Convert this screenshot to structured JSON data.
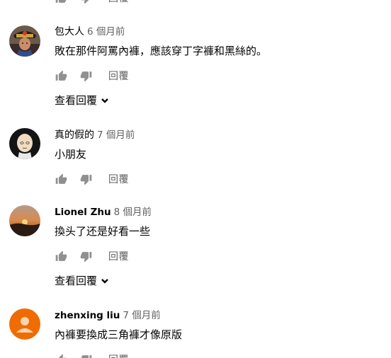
{
  "reply_label": "回覆",
  "view_replies_label": "查看回覆",
  "comments": [
    {
      "author": "包大人",
      "time": "6 個月前",
      "text": "敗在那件阿罵內褲，應該穿丁字褲和黑絲的。",
      "avatar": "costume-character-avatar"
    },
    {
      "author": "真的假的",
      "time": "7 個月前",
      "text": "小朋友",
      "avatar": "bald-cartoon-avatar"
    },
    {
      "author": "Lionel Zhu",
      "time": "8 個月前",
      "text": "換头了还是好看一些",
      "avatar": "sunset-avatar"
    },
    {
      "author": "zhenxing liu",
      "time": "7 個月前",
      "text": "內褲要換成三角褲才像原版",
      "avatar": "default-person-avatar",
      "avatar_color": "#ef6c00"
    }
  ]
}
